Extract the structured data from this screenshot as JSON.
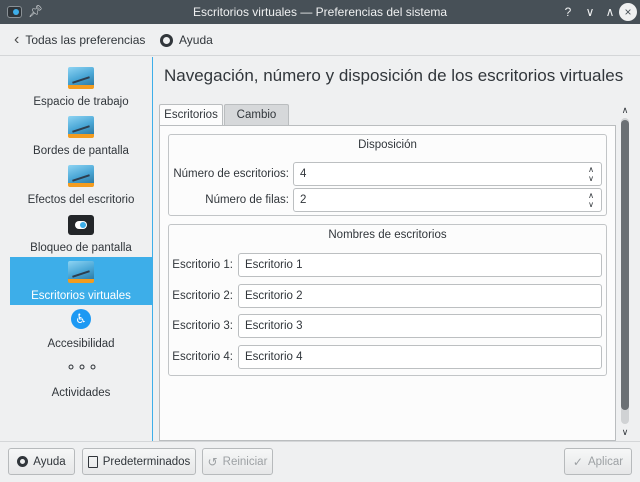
{
  "window": {
    "title": "Escritorios virtuales  — Preferencias del sistema",
    "controls": [
      "?",
      "∨",
      "∧",
      "×"
    ]
  },
  "toolbar": {
    "back_label": "Todas las preferencias",
    "help_label": "Ayuda"
  },
  "sidebar": {
    "items": [
      {
        "label": "Espacio de trabajo",
        "icon": "desktop-icon",
        "active": false
      },
      {
        "label": "Bordes de pantalla",
        "icon": "desktop-icon",
        "active": false
      },
      {
        "label": "Efectos del escritorio",
        "icon": "desktop-icon",
        "active": false
      },
      {
        "label": "Bloqueo de pantalla",
        "icon": "lock-toggle-icon",
        "active": false
      },
      {
        "label": "Escritorios virtuales",
        "icon": "desktop-icon",
        "active": true
      },
      {
        "label": "Accesibilidad",
        "icon": "accessibility-icon",
        "glyph": "♿",
        "active": false
      },
      {
        "label": "Actividades",
        "icon": "activities-icon",
        "glyph": "∘∘∘",
        "active": false
      }
    ]
  },
  "main": {
    "title": "Navegación, número y disposición de los escritorios virtuales",
    "tabs": [
      {
        "label": "Escritorios",
        "active": true
      },
      {
        "label": "Cambio",
        "active": false
      }
    ],
    "layout_group": {
      "title": "Disposición",
      "num_desktops_label": "Número de escritorios:",
      "num_desktops_value": "4",
      "num_rows_label": "Número de filas:",
      "num_rows_value": "2"
    },
    "names_group": {
      "title": "Nombres de escritorios",
      "desktops": [
        {
          "label": "Escritorio 1:",
          "value": "Escritorio 1"
        },
        {
          "label": "Escritorio 2:",
          "value": "Escritorio 2"
        },
        {
          "label": "Escritorio 3:",
          "value": "Escritorio 3"
        },
        {
          "label": "Escritorio 4:",
          "value": "Escritorio 4"
        }
      ]
    }
  },
  "footer": {
    "help_label": "Ayuda",
    "defaults_label": "Predeterminados",
    "reset_label": "Reiniciar",
    "apply_label": "Aplicar"
  },
  "colors": {
    "accent": "#3daee9",
    "titlebar": "#475057",
    "window_bg": "#eff0f1"
  }
}
